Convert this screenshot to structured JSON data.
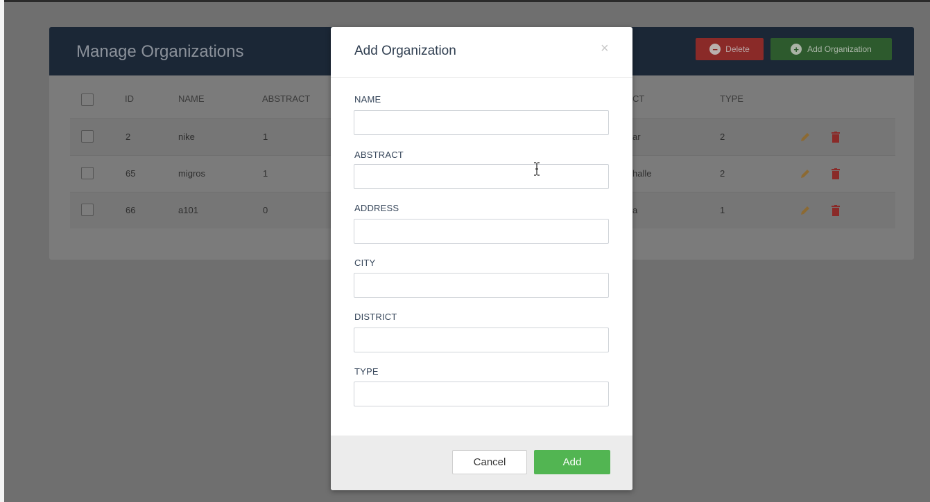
{
  "page": {
    "title": "Manage Organizations",
    "delete_label": "Delete",
    "add_org_label": "Add Organization"
  },
  "table": {
    "columns": [
      "ID",
      "NAME",
      "ABSTRACT",
      "CT",
      "TYPE"
    ],
    "rows": [
      {
        "id": "2",
        "name": "nike",
        "abstract": "1",
        "district": "ar",
        "type": "2"
      },
      {
        "id": "65",
        "name": "migros",
        "abstract": "1",
        "district": "halle",
        "type": "2"
      },
      {
        "id": "66",
        "name": "a101",
        "abstract": "0",
        "district": "a",
        "type": "1"
      }
    ]
  },
  "modal": {
    "title": "Add Organization",
    "close_symbol": "×",
    "fields": [
      {
        "label": "NAME",
        "value": "",
        "placeholder": ""
      },
      {
        "label": "ABSTRACT",
        "value": "",
        "placeholder": ""
      },
      {
        "label": "ADDRESS",
        "value": "",
        "placeholder": ""
      },
      {
        "label": "CITY",
        "value": "",
        "placeholder": ""
      },
      {
        "label": "DISTRICT",
        "value": "",
        "placeholder": ""
      },
      {
        "label": "TYPE",
        "value": "",
        "placeholder": ""
      }
    ],
    "cancel_label": "Cancel",
    "add_label": "Add"
  },
  "icons": {
    "delete": "minus-circle-icon",
    "add": "plus-circle-icon",
    "edit": "pencil-icon",
    "remove": "trash-icon",
    "cursor": "text-cursor-icon"
  },
  "colors": {
    "header_bg": "#1b2736",
    "delete_btn": "#d9534f",
    "add_btn": "#5cb85c",
    "modal_title": "#2f3e50",
    "edit_icon": "#f0ad4e",
    "trash_icon": "#d9534f"
  }
}
